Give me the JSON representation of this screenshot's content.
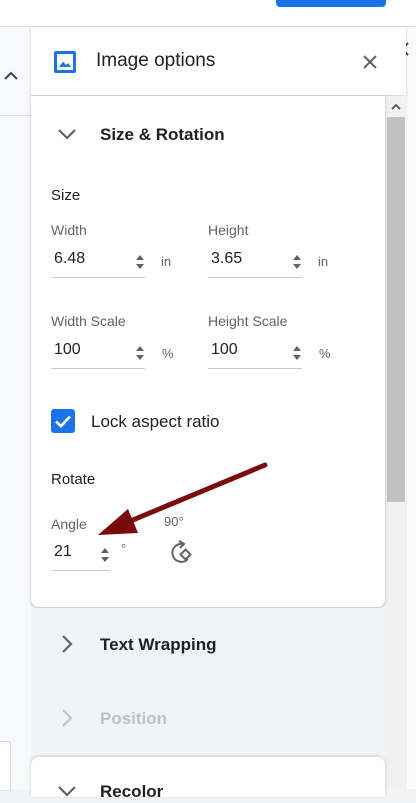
{
  "panel": {
    "title": "Image options"
  },
  "size_rotation": {
    "header": "Size & Rotation",
    "size_title": "Size",
    "width": {
      "label": "Width",
      "value": "6.48",
      "unit": "in"
    },
    "height": {
      "label": "Height",
      "value": "3.65",
      "unit": "in"
    },
    "width_scale": {
      "label": "Width Scale",
      "value": "100",
      "unit": "%"
    },
    "height_scale": {
      "label": "Height Scale",
      "value": "100",
      "unit": "%"
    },
    "lock_aspect": {
      "label": "Lock aspect ratio",
      "checked": true
    },
    "rotate_title": "Rotate",
    "angle": {
      "label": "Angle",
      "value": "21",
      "unit": "°"
    },
    "rotate_90_label": "90°"
  },
  "sections": {
    "text_wrapping": "Text Wrapping",
    "position": "Position",
    "recolor": "Recolor"
  },
  "colors": {
    "accent": "#1a73e8",
    "annotation_arrow": "#7b0b0b"
  }
}
